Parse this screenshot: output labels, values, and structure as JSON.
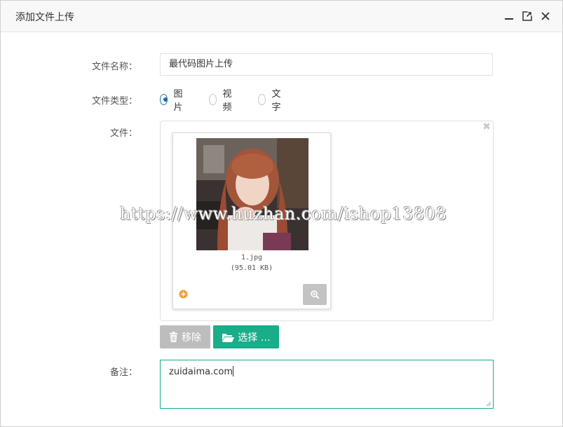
{
  "dialog": {
    "title": "添加文件上传"
  },
  "form": {
    "name_label": "文件名称：",
    "name_value": "最代码图片上传",
    "type_label": "文件类型：",
    "type_options": [
      {
        "label": "图片",
        "checked": true
      },
      {
        "label": "视频",
        "checked": false
      },
      {
        "label": "文字",
        "checked": false
      }
    ],
    "file_label": "文件：",
    "note_label": "备注：",
    "note_value": "zuidaima.com"
  },
  "upload": {
    "file_name": "1.jpg",
    "file_size": "(95.01 KB)",
    "remove_label": "移除",
    "select_label": "选择 …"
  },
  "watermark": "https://www.huzhan.com/ishop13808",
  "colors": {
    "accent": "#1aad8a",
    "radio_checked": "#1e6aa8",
    "remove_btn": "#bdbdbd"
  }
}
